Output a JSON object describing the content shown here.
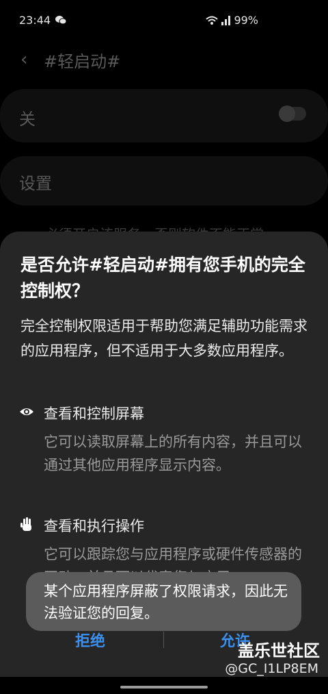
{
  "status": {
    "time": "23:44",
    "battery": "99%",
    "icons": [
      "wechat-icon",
      "wifi-icon",
      "4g-signal-icon"
    ]
  },
  "appbar": {
    "title": "#轻启动#"
  },
  "settings": {
    "toggle_label": "关",
    "settings_label": "设置",
    "partial_text": "必须开启该服务，否则软件不能正常"
  },
  "dialog": {
    "title": "是否允许#轻启动#拥有您手机的完全控制权？",
    "description": "完全控制权限适用于帮助您满足辅助功能需求的应用程序，但不适用于大多数应用程序。",
    "permissions": [
      {
        "icon": "eye-icon",
        "title": "查看和控制屏幕",
        "desc": "它可以读取屏幕上的所有内容，并且可以通过其他应用程序显示内容。"
      },
      {
        "icon": "hand-icon",
        "title": "查看和执行操作",
        "desc": "它可以跟踪您与应用程序或硬件传感器的互动，并且可以代表您与应用"
      }
    ],
    "deny_label": "拒绝",
    "allow_label": "允许"
  },
  "toast": {
    "text": "某个应用程序屏蔽了权限请求，因此无法验证您的回复。"
  },
  "watermark": {
    "brand": "盖乐世社区",
    "user": "@GC_I1LP8EM"
  },
  "colors": {
    "accent": "#3a8ff0",
    "sheet": "#262626",
    "toast": "#5b5b5b"
  }
}
